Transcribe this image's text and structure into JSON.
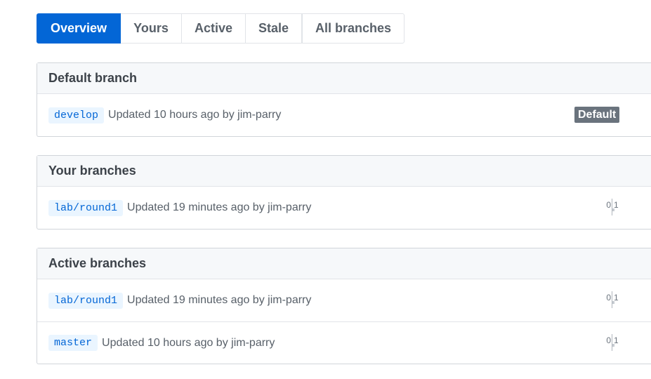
{
  "tabs": [
    {
      "label": "Overview",
      "selected": true
    },
    {
      "label": "Yours",
      "selected": false
    },
    {
      "label": "Active",
      "selected": false
    },
    {
      "label": "Stale",
      "selected": false
    },
    {
      "label": "All branches",
      "selected": false
    }
  ],
  "default_section": {
    "title": "Default branch",
    "rows": [
      {
        "branch": "develop",
        "updated": "Updated 10 hours ago by",
        "author": "jim-parry",
        "badge": "Default"
      }
    ]
  },
  "yours_section": {
    "title": "Your branches",
    "rows": [
      {
        "branch": "lab/round1",
        "updated": "Updated 19 minutes ago by",
        "author": "jim-parry",
        "behind": "0",
        "ahead": "1"
      }
    ]
  },
  "active_section": {
    "title": "Active branches",
    "rows": [
      {
        "branch": "lab/round1",
        "updated": "Updated 19 minutes ago by",
        "author": "jim-parry",
        "behind": "0",
        "ahead": "1"
      },
      {
        "branch": "master",
        "updated": "Updated 10 hours ago by",
        "author": "jim-parry",
        "behind": "0",
        "ahead": "1"
      }
    ]
  },
  "colors": {
    "accent": "#0366d6",
    "badge": "#6a737d",
    "branch_bg": "#eaf5ff"
  }
}
